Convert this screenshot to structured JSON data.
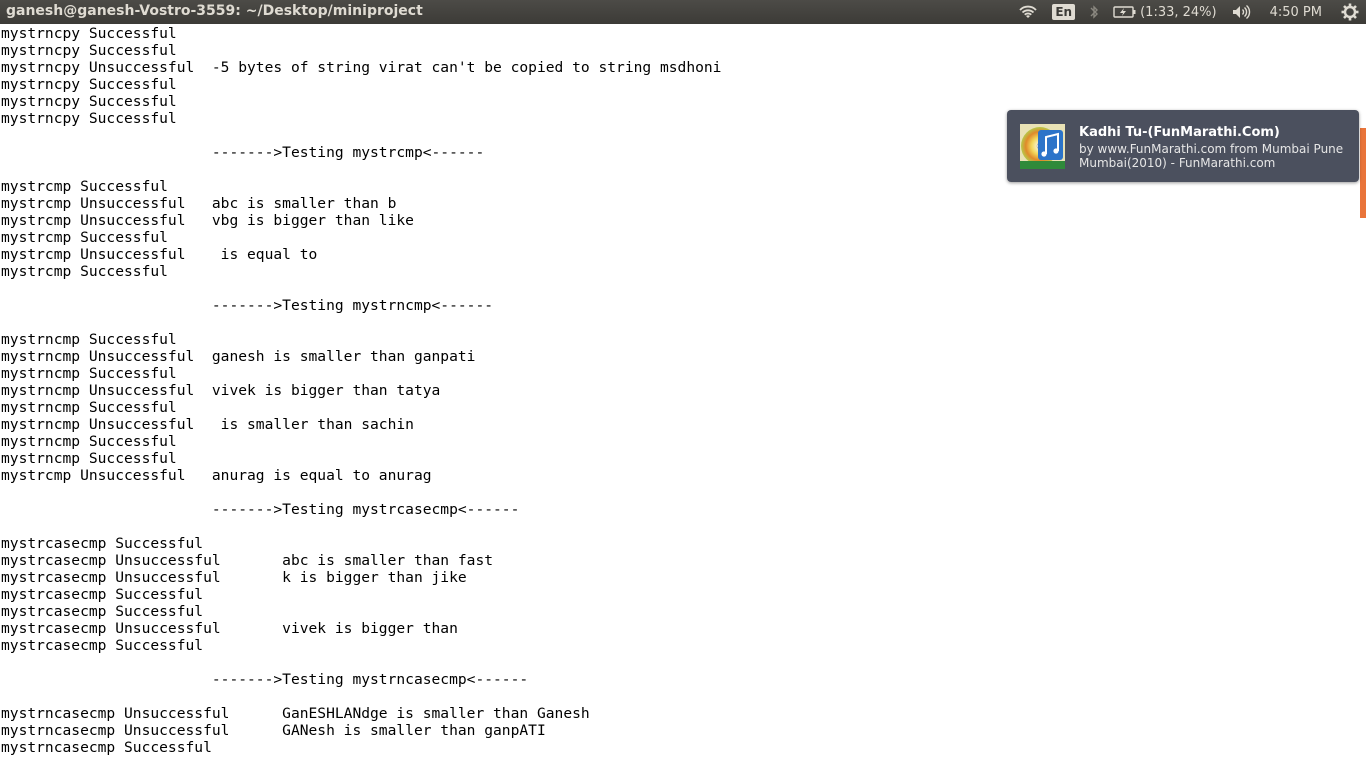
{
  "topbar": {
    "window_title": "ganesh@ganesh-Vostro-3559: ~/Desktop/miniproject",
    "language": "En",
    "battery_text": "(1:33, 24%)",
    "clock": "4:50 PM",
    "icons": [
      "wifi-icon",
      "bluetooth-icon",
      "battery-icon",
      "volume-icon",
      "gear-icon"
    ]
  },
  "notification": {
    "title": "Kadhi Tu-(FunMarathi.Com)",
    "body": "by www.FunMarathi.com from Mumbai Pune Mumbai(2010) - FunMarathi.com",
    "icon": "music-album-icon"
  },
  "terminal": {
    "lines": [
      "mystrncpy Successful",
      "mystrncpy Successful",
      "mystrncpy Unsuccessful  -5 bytes of string virat can't be copied to string msdhoni",
      "mystrncpy Successful",
      "mystrncpy Successful",
      "mystrncpy Successful",
      "",
      "                        ------->Testing mystrcmp<------",
      "",
      "mystrcmp Successful",
      "mystrcmp Unsuccessful   abc is smaller than b",
      "mystrcmp Unsuccessful   vbg is bigger than like",
      "mystrcmp Successful",
      "mystrcmp Unsuccessful    is equal to",
      "mystrcmp Successful",
      "",
      "                        ------->Testing mystrncmp<------",
      "",
      "mystrncmp Successful",
      "mystrncmp Unsuccessful  ganesh is smaller than ganpati",
      "mystrncmp Successful",
      "mystrncmp Unsuccessful  vivek is bigger than tatya",
      "mystrncmp Successful",
      "mystrncmp Unsuccessful   is smaller than sachin",
      "mystrncmp Successful",
      "mystrncmp Successful",
      "mystrcmp Unsuccessful   anurag is equal to anurag",
      "",
      "                        ------->Testing mystrcasecmp<------",
      "",
      "mystrcasecmp Successful",
      "mystrcasecmp Unsuccessful       abc is smaller than fast",
      "mystrcasecmp Unsuccessful       k is bigger than jike",
      "mystrcasecmp Successful",
      "mystrcasecmp Successful",
      "mystrcasecmp Unsuccessful       vivek is bigger than",
      "mystrcasecmp Successful",
      "",
      "                        ------->Testing mystrncasecmp<------",
      "",
      "mystrncasecmp Unsuccessful      GanESHLANdge is smaller than Ganesh",
      "mystrncasecmp Unsuccessful      GANesh is smaller than ganpATI",
      "mystrncasecmp Successful"
    ]
  }
}
